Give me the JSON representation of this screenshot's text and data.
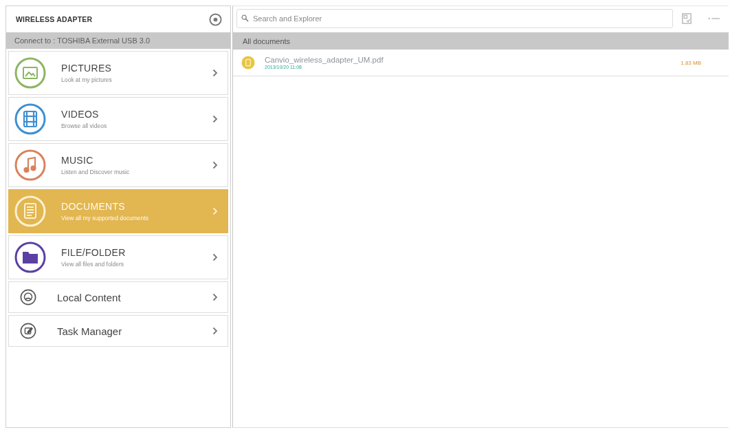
{
  "sidebar": {
    "title": "WIRELESS ADAPTER",
    "connection": "Connect to : TOSHIBA External USB 3.0",
    "items": [
      {
        "kind": "category",
        "title": "PICTURES",
        "subtitle": "Look at my pictures",
        "color": "#8db563",
        "selected": false
      },
      {
        "kind": "category",
        "title": "VIDEOS",
        "subtitle": "Browse all videos",
        "color": "#3f8fd2",
        "selected": false
      },
      {
        "kind": "category",
        "title": "MUSIC",
        "subtitle": "Listen and Discover music",
        "color": "#d9825c",
        "selected": false
      },
      {
        "kind": "category",
        "title": "DOCUMENTS",
        "subtitle": "View all my supported documents",
        "color": "#e2b650",
        "selected": true
      },
      {
        "kind": "category",
        "title": "FILE/FOLDER",
        "subtitle": "View all files and folders",
        "color": "#5b3fa3",
        "selected": false
      },
      {
        "kind": "link",
        "title": "Local Content",
        "color": "#555555",
        "selected": false
      },
      {
        "kind": "link",
        "title": "Task Manager",
        "color": "#555555",
        "selected": false
      }
    ]
  },
  "search": {
    "placeholder": "Search and Explorer"
  },
  "section": {
    "title": "All documents"
  },
  "files": [
    {
      "name": "Canvio_wireless_adapter_UM.pdf",
      "date": "2013/10/20 11:08",
      "size": "1.83 MB"
    }
  ]
}
